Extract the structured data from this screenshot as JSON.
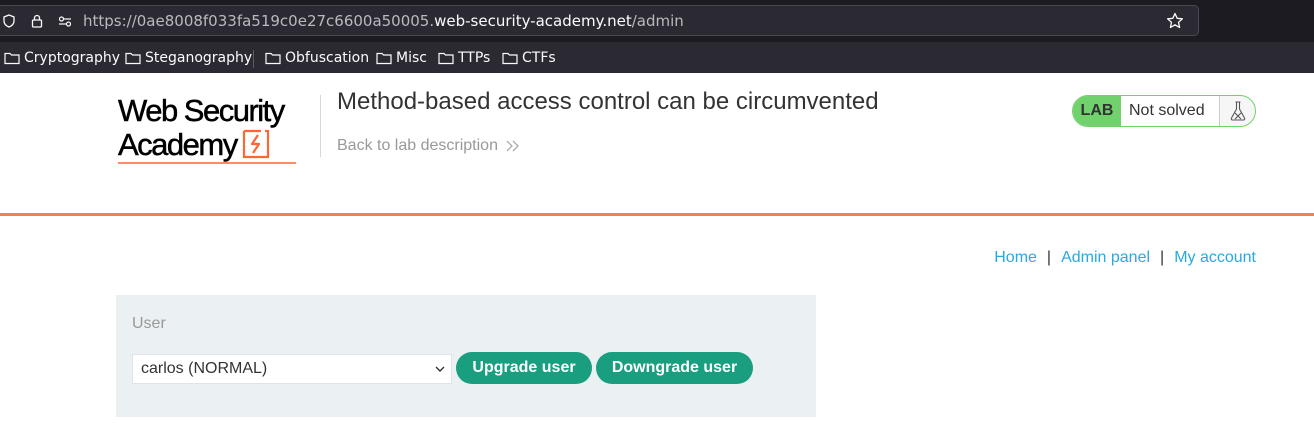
{
  "browser": {
    "url_prefix": "https://0ae8008f033fa519c0e27c6600a50005.",
    "url_host": "web-security-academy.net",
    "url_path": "/admin",
    "bookmarks": [
      {
        "label": "Cryptography",
        "icon": "folder-icon"
      },
      {
        "label": "Steganography",
        "icon": "folder-icon"
      },
      {
        "label": "Obfuscation",
        "icon": "folder-icon"
      },
      {
        "label": "Misc",
        "icon": "folder-icon"
      },
      {
        "label": "TTPs",
        "icon": "folder-icon"
      },
      {
        "label": "CTFs",
        "icon": "folder-icon"
      }
    ]
  },
  "header": {
    "logo_line1": "Web Security",
    "logo_line2": "Academy",
    "lab_title": "Method-based access control can be circumvented",
    "back_link": "Back to lab description",
    "badge_label": "LAB",
    "badge_status": "Not solved"
  },
  "nav": {
    "home": "Home",
    "separator": "|",
    "admin_panel": "Admin panel",
    "my_account": "My account"
  },
  "admin": {
    "user_label": "User",
    "selected_user": "carlos (NORMAL)",
    "upgrade_button": "Upgrade user",
    "downgrade_button": "Downgrade user"
  },
  "colors": {
    "accent_orange": "#ff6633",
    "button_green": "#1a9e80",
    "lab_green": "#70d16d",
    "link_blue": "#29a9e1"
  }
}
